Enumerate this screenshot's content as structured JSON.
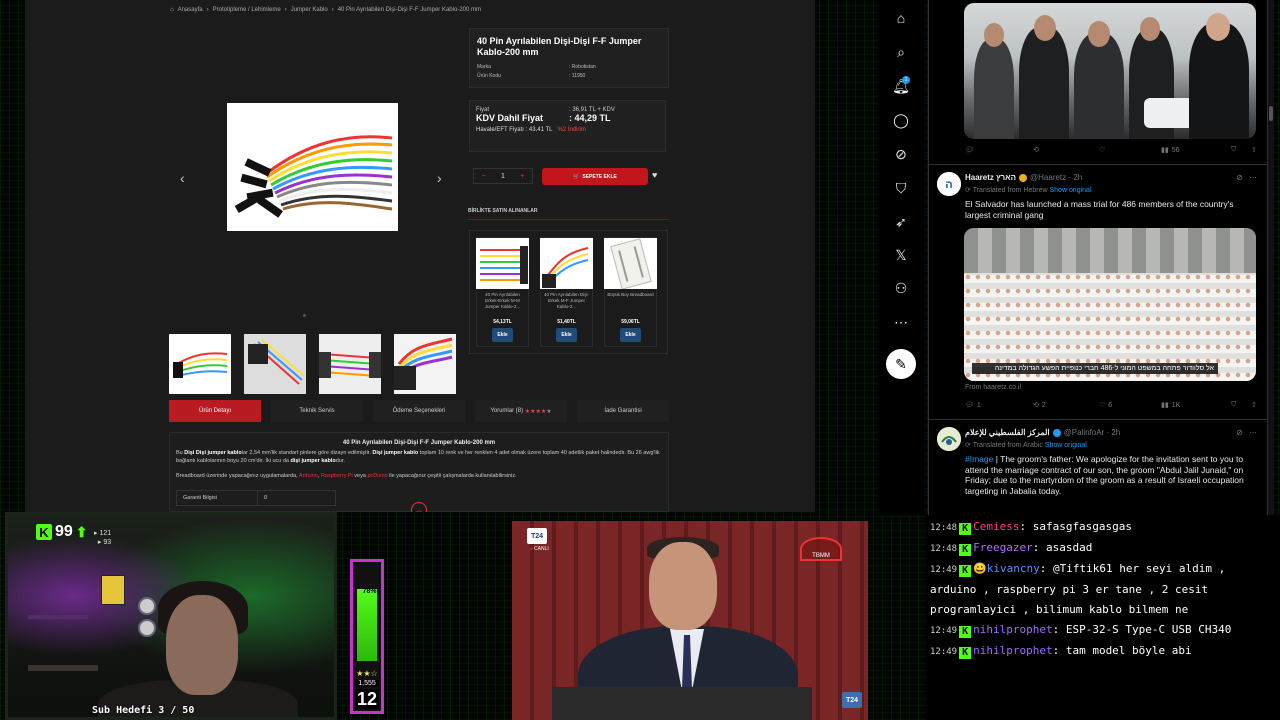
{
  "shop": {
    "breadcrumb": [
      "Anasayfa",
      "Prototipleme / Lehimleme",
      "Jumper Kablo",
      "40 Pin Ayrılabilen Dişi-Dişi F-F Jumper Kablo-200 mm"
    ],
    "title": "40 Pin Ayrılabilen Dişi-Dişi F-F Jumper Kablo-200 mm",
    "brand_label": "Marka",
    "brand_value": ": Robotistan",
    "code_label": "Ürün Kodu",
    "code_value": ": 11950",
    "price_label": "Fiyat",
    "price_value": ": 36,91 TL + KDV",
    "vat_label": "KDV Dahil Fiyat",
    "vat_value": ": 44,29 TL",
    "eft_label": "Havale/EFT Fiyatı : 43,41 TL",
    "eft_discount": "%2 İndirim",
    "qty": "1",
    "add_to_cart": "SEPETE EKLE",
    "together_title": "BİRLİKTE SATIN ALINANLAR",
    "related": [
      {
        "name": "40 Pin Ayrılabilen Erkek-Erkek M-M Jumper Kablo-2...",
        "price": "54,13TL",
        "btn": "Ekle"
      },
      {
        "name": "40 Pin Ayrılabilen Dişi-Erkek M-F Jumper Kablo-2...",
        "price": "51,40TL",
        "btn": "Ekle"
      },
      {
        "name": "Büyük Boy Breadboard",
        "price": "59,06TL",
        "btn": "Ekle"
      }
    ],
    "tabs": [
      "Ürün Detayı",
      "Teknik Servis",
      "Ödeme Seçenekleri",
      "Yorumlar (8)",
      "İade Garantisi"
    ],
    "desc_title": "40 Pin Ayrılabilen Dişi-Dişi F-F Jumper Kablo-200 mm",
    "desc_1a": "Bu ",
    "desc_1b": "Dişi Dişi jumper kablo",
    "desc_1c": "lar 2,54 mm'lik standart pinlere göre dizayn edilmiştir. ",
    "desc_1d": "Dişi jumper kablo",
    "desc_1e": " toplam 10 renk ve her renkten 4 adet olmak üzere toplam 40 adetlik paket halindedir. Bu 26 awg'lik bağlantı kablolarının boyu 20 cm'dir. İki ucu da ",
    "desc_1f": "dişi jumper kablo",
    "desc_1g": "dur.",
    "desc_2a": "Breadboard üzerinde yapacağınız uygulamalarda, ",
    "desc_2b": "Arduino",
    "desc_2c": ", ",
    "desc_2d": "Raspberry Pi",
    "desc_2e": " veya ",
    "desc_2f": "pcDuino",
    "desc_2g": " ile yapacağınız çeşitli çalışmalarda kullanılabilirsiniz.",
    "warranty_label": "Garanti Bilgisi",
    "warranty_value": "0"
  },
  "tweets": [
    {
      "likes_reply": "",
      "retweets": "",
      "likes": "",
      "views": "56"
    },
    {
      "name": "Haaretz הארץ",
      "handle": "@Haaretz · 2h",
      "translated": "Translated from Hebrew",
      "show_original": "Show original",
      "text": "El Salvador has launched a mass trial for 486 members of the country's largest criminal gang",
      "caption": "אל סלוודור פתחה במשפט המוני ל-486 חברי כנופיית הפשע הגדולה במדינה",
      "from": "From haaretz.co.il",
      "replies": "1",
      "retweets": "2",
      "likes": "6",
      "views": "1K"
    },
    {
      "name": "المركز الفلسطيني للإعلام",
      "handle": "@PalinfoAr · 2h",
      "translated": "Translated from Arabic",
      "show_original": "Show original",
      "tag": "#Image",
      "text": " | The groom's father: We apologize for the invitation sent to you to attend the marriage contract of our son, the groom \"Abdul Jalil Junaid,\" on Friday; due to the martyrdom of the groom as a result of Israeli occupation targeting in Jabalia today."
    }
  ],
  "stream": {
    "followers": "99",
    "stat_a": "121",
    "stat_b": "93",
    "sub_goal": "Sub Hedefi 3 / 50",
    "meter_percent": "78%",
    "meter_level": 0.78,
    "meter_count": "1,555",
    "meter_big": "12",
    "tv_logo": "T24",
    "tv_live": "CANLI",
    "tv_channel": "TBMM",
    "tv_logo_small": "T24"
  },
  "chat": [
    {
      "time": "12:48",
      "user": "Cemiess",
      "text": "safasgfasgasgas"
    },
    {
      "time": "12:48",
      "user": "Freegazer",
      "text": "asasdad"
    },
    {
      "time": "12:49",
      "user": "kivancny",
      "text": "@Tiftik61 her seyi aldim , arduino , raspberry pi 3 er tane , 2 cesit programlayici , bilimum kablo bilmem ne"
    },
    {
      "time": "12:49",
      "user": "nihilprophet",
      "text": "ESP-32-S Type-C USB CH340"
    },
    {
      "time": "12:49",
      "user": "nihilprophet",
      "text": "tam model böyle abi"
    }
  ],
  "colors": {
    "accent_red": "#c2161c",
    "twitter_blue": "#1d9bf0",
    "kick_green": "#53fc18"
  }
}
